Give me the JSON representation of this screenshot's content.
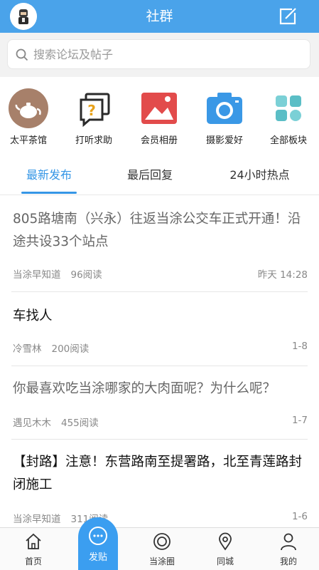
{
  "header": {
    "title": "社群"
  },
  "search": {
    "placeholder": "搜索论坛及帖子"
  },
  "categories": [
    {
      "label": "太平茶馆",
      "icon": "teapot-icon"
    },
    {
      "label": "打听求助",
      "icon": "question-chat-icon"
    },
    {
      "label": "会员相册",
      "icon": "photo-album-icon"
    },
    {
      "label": "摄影爱好",
      "icon": "camera-icon"
    },
    {
      "label": "全部板块",
      "icon": "grid-icon"
    }
  ],
  "tabs": [
    {
      "label": "最新发布",
      "active": true
    },
    {
      "label": "最后回复",
      "active": false
    },
    {
      "label": "24小时热点",
      "active": false
    }
  ],
  "posts": [
    {
      "title": "805路塘南（兴永）往返当涂公交车正式开通！沿途共设33个站点",
      "author": "当涂早知道",
      "reads": "96阅读",
      "right": "昨天 14:28"
    },
    {
      "title": "车找人",
      "author": "冷雪林",
      "reads": "200阅读",
      "right": "1-8"
    },
    {
      "title": "你最喜欢吃当涂哪家的大肉面呢？为什么呢？",
      "author": "遇见木木",
      "reads": "455阅读",
      "right": "1-7"
    },
    {
      "title": "【封路】注意！东营路南至提署路，北至青莲路封闭施工",
      "author": "当涂早知道",
      "reads": "311阅读",
      "right": "1-6"
    }
  ],
  "bottom_nav": [
    {
      "label": "首页",
      "icon": "home-icon"
    },
    {
      "label": "发贴",
      "icon": "chat-bubble-icon"
    },
    {
      "label": "当涂圈",
      "icon": "circle-target-icon"
    },
    {
      "label": "同城",
      "icon": "location-pin-icon"
    },
    {
      "label": "我的",
      "icon": "user-icon"
    }
  ],
  "colors": {
    "header_bg": "#4aa3ea",
    "accent": "#3596e6",
    "post_button": "#3b9ef0"
  }
}
